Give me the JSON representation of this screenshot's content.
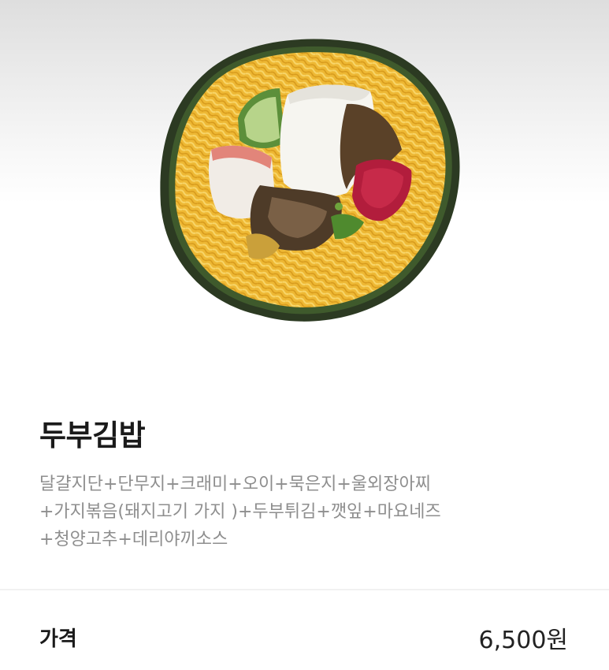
{
  "product": {
    "image_alt": "gimbap-roll-cross-section",
    "name": "두부김밥",
    "description_lines": [
      "달걀지단+단무지+크래미+오이+묵은지+울외장아찌",
      "+가지볶음(돼지고기 가지 )+두부튀김+깻잎+마요네즈",
      "+청양고추+데리야끼소스"
    ]
  },
  "price": {
    "label": "가격",
    "value": "6,500원"
  }
}
